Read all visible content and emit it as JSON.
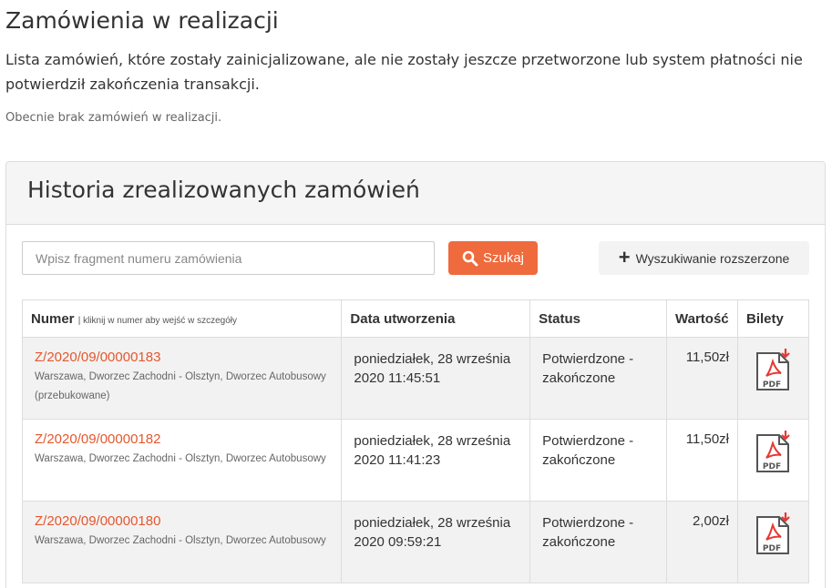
{
  "page": {
    "title": "Zamówienia w realizacji",
    "description": "Lista zamówień, które zostały zainicjalizowane, ale nie zostały jeszcze przetworzone lub system płatności nie potwierdził zakończenia transakcji.",
    "empty_message": "Obecnie brak zamówień w realizacji."
  },
  "history": {
    "title": "Historia zrealizowanych zamówień",
    "search_placeholder": "Wpisz fragment numeru zamówienia",
    "search_button": "Szukaj",
    "advanced_button": "Wyszukiwanie rozszerzone",
    "columns": {
      "number": "Numer",
      "number_hint": "| kliknij w numer aby wejść w szczegóły",
      "created": "Data utworzenia",
      "status": "Status",
      "value": "Wartość",
      "tickets": "Bilety"
    },
    "orders": [
      {
        "number": "Z/2020/09/00000183",
        "route": "Warszawa, Dworzec Zachodni - Olsztyn, Dworzec Autobusowy (przebukowane)",
        "date": "poniedziałek, 28 września 2020 11:45:51",
        "status": "Potwierdzone - zakończone",
        "value": "11,50zł",
        "ticket_icon": "pdf-download-icon"
      },
      {
        "number": "Z/2020/09/00000182",
        "route": "Warszawa, Dworzec Zachodni - Olsztyn, Dworzec Autobusowy",
        "date": "poniedziałek, 28 września 2020 11:41:23",
        "status": "Potwierdzone - zakończone",
        "value": "11,50zł",
        "ticket_icon": "pdf-download-icon"
      },
      {
        "number": "Z/2020/09/00000180",
        "route": "Warszawa, Dworzec Zachodni - Olsztyn, Dworzec Autobusowy",
        "date": "poniedziałek, 28 września 2020 09:59:21",
        "status": "Potwierdzone - zakończone",
        "value": "2,00zł",
        "ticket_icon": "pdf-download-icon"
      }
    ]
  },
  "colors": {
    "accent": "#ef6a3c",
    "link": "#e4572e",
    "pdf_red": "#e53935"
  }
}
